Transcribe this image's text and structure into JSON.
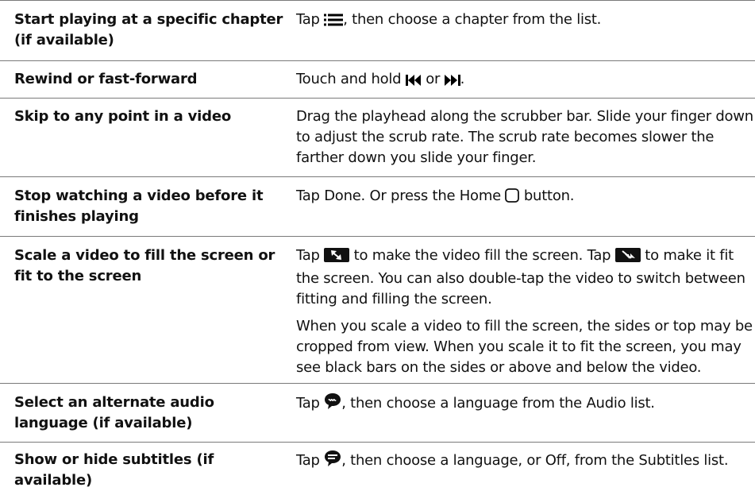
{
  "rows": [
    {
      "task": "Start playing at a specific chapter (if available)",
      "desc": [
        [
          "Tap ",
          "@chapters-icon",
          ", then choose a chapter from the list."
        ]
      ]
    },
    {
      "task": "Rewind or fast-forward",
      "desc": [
        [
          "Touch and hold ",
          "@rewind-icon",
          " or ",
          "@fast-forward-icon",
          "."
        ]
      ]
    },
    {
      "task": "Skip to any point in a video",
      "desc": [
        [
          "Drag the playhead along the scrubber bar. Slide your finger down to adjust the scrub rate. The scrub rate becomes slower the farther down you slide your finger."
        ]
      ]
    },
    {
      "task": "Stop watching a video before it finishes playing",
      "desc": [
        [
          "Tap Done. Or press the Home ",
          "@home-button-icon",
          " button."
        ]
      ]
    },
    {
      "task": "Scale a video to fill the screen or fit to the screen",
      "desc": [
        [
          "Tap ",
          "@fill-screen-icon",
          " to make the video fill the screen. Tap ",
          "@fit-screen-icon",
          " to make it fit the screen. You can also double-tap the video to switch between fitting and filling the screen."
        ],
        [
          "When you scale a video to fill the screen, the sides or top may be cropped from view. When you scale it to fit the screen, you may see black bars on the sides or above and below the video."
        ]
      ]
    },
    {
      "task": "Select an alternate audio language (if available)",
      "desc": [
        [
          "Tap ",
          "@audio-language-icon",
          ", then choose a language from the Audio list."
        ]
      ]
    },
    {
      "task": "Show or hide subtitles (if available)",
      "desc": [
        [
          "Tap ",
          "@subtitles-icon",
          ", then choose a language, or Off, from the Subtitles list."
        ]
      ]
    }
  ]
}
